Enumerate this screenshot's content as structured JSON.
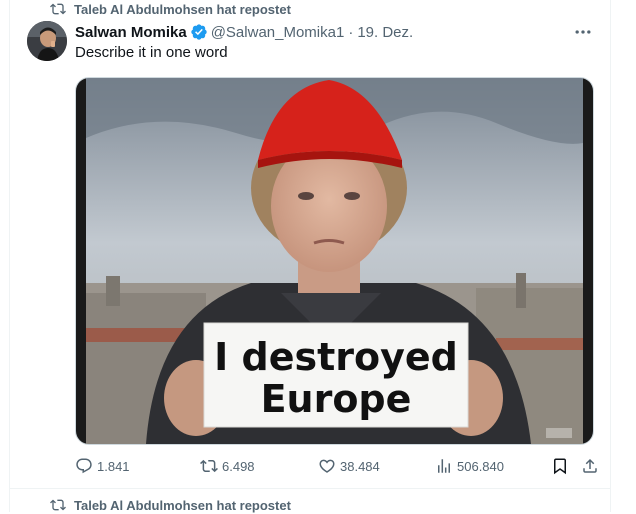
{
  "repost": {
    "label": "Taleb Al Abdulmohsen hat repostet"
  },
  "tweet": {
    "display_name": "Salwan Momika",
    "handle": "@Salwan_Momika1",
    "separator": "·",
    "date": "19. Dez.",
    "text": "Describe it in one word",
    "image_sign_line1": "I destroyed",
    "image_sign_line2": "Europe",
    "actions": {
      "replies": "1.841",
      "reposts": "6.498",
      "likes": "38.484",
      "views": "506.840"
    }
  },
  "next_repost": {
    "label": "Taleb Al Abdulmohsen hat repostet"
  },
  "colors": {
    "accent": "#1d9bf0",
    "muted": "#536471",
    "text": "#0f1419"
  },
  "icons": [
    "repost-icon",
    "verified-badge-icon",
    "more-icon",
    "reply-icon",
    "retweet-icon",
    "like-icon",
    "views-icon",
    "bookmark-icon",
    "share-icon"
  ]
}
